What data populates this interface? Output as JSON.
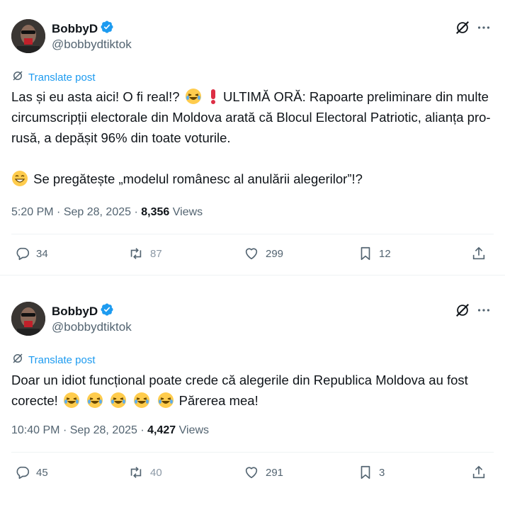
{
  "posts": [
    {
      "author": {
        "name": "BobbyD",
        "handle": "@bobbydtiktok"
      },
      "translate_label": "Translate post",
      "text": {
        "p1_a": "Las și eu asta aici! O fi real!?",
        "p1_b": "ULTIMĂ ORĂ: Rapoarte preliminare din multe circumscripții electorale din Moldova arată că Blocul Electoral Patriotic, alianța pro-rusă, a depășit 96% din toate voturile.",
        "p2": "Se pregătește „modelul românesc al anulării alegerilor”!?"
      },
      "time": "5:20 PM",
      "date": "Sep 28, 2025",
      "views_count": "8,356",
      "views_label": "Views",
      "stats": {
        "replies": "34",
        "reposts": "87",
        "likes": "299",
        "bookmarks": "12"
      }
    },
    {
      "author": {
        "name": "BobbyD",
        "handle": "@bobbydtiktok"
      },
      "translate_label": "Translate post",
      "text": {
        "p1_a": "Doar un idiot funcțional poate crede că alegerile din Republica Moldova au fost corecte!",
        "p1_b": "Părerea mea!"
      },
      "time": "10:40 PM",
      "date": "Sep 28, 2025",
      "views_count": "4,427",
      "views_label": "Views",
      "stats": {
        "replies": "45",
        "reposts": "40",
        "likes": "291",
        "bookmarks": "3"
      }
    }
  ],
  "separator": "·",
  "icons": [
    "verified-badge-icon",
    "grok-icon",
    "more-icon",
    "translate-icon",
    "reply-icon",
    "repost-icon",
    "like-icon",
    "bookmark-icon",
    "share-icon",
    "laughing-emoji-icon",
    "grinning-emoji-icon",
    "exclamation-emoji-icon"
  ],
  "colors": {
    "accent": "#1d9bf0",
    "text": "#0f1419",
    "muted": "#536471",
    "divider": "#eff3f4",
    "verified": "#1d9bf0",
    "emoji": "#ffcc4d",
    "exclamation": "#dd2e44"
  }
}
